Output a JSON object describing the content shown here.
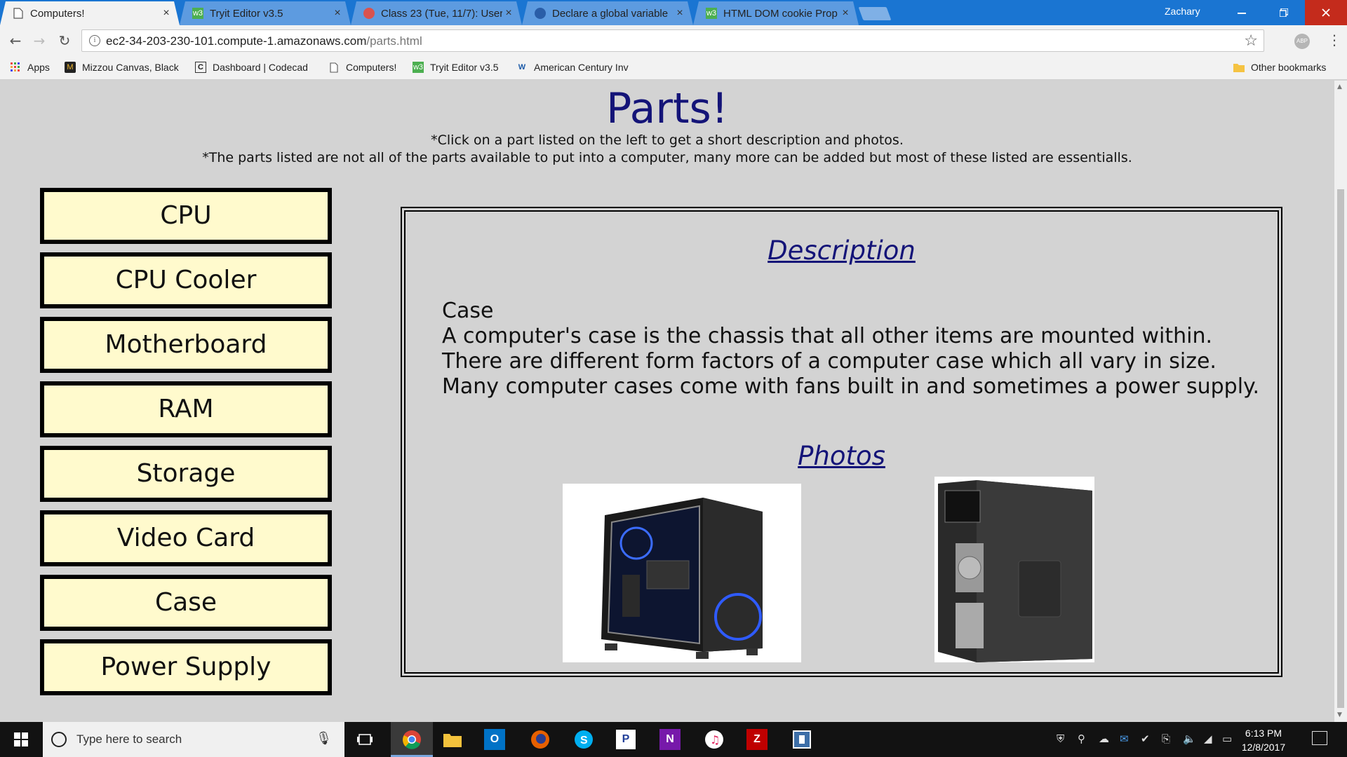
{
  "browser": {
    "tabs": [
      {
        "title": "Computers!",
        "icon": "page-icon"
      },
      {
        "title": "Tryit Editor v3.5",
        "icon": "w3schools-icon"
      },
      {
        "title": "Class 23 (Tue, 11/7): User",
        "icon": "course-icon"
      },
      {
        "title": "Declare a global variable",
        "icon": "site-icon"
      },
      {
        "title": "HTML DOM cookie Prop",
        "icon": "w3schools-icon"
      }
    ],
    "profile_name": "Zachary",
    "url_host": "ec2-34-203-230-101.compute-1.amazonaws.com",
    "url_path": "/parts.html",
    "abp_label": "ABP",
    "bookmarks": [
      {
        "label": "Apps",
        "icon": "apps-grid-icon"
      },
      {
        "label": "Mizzou Canvas, Black",
        "icon": "mizzou-icon"
      },
      {
        "label": "Dashboard | Codecad",
        "icon": "codecademy-icon"
      },
      {
        "label": "Computers!",
        "icon": "page-icon"
      },
      {
        "label": "Tryit Editor v3.5",
        "icon": "w3schools-icon"
      },
      {
        "label": "American Century Inv",
        "icon": "american-century-icon"
      }
    ],
    "other_bookmarks": "Other bookmarks"
  },
  "page": {
    "heading": "Parts!",
    "note1": "*Click on a part listed on the left to get a short description and photos.",
    "note2": "*The parts listed are not all of the parts available to put into a computer, many more can be added but most of these listed are essentialls.",
    "parts": [
      "CPU",
      "CPU Cooler",
      "Motherboard",
      "RAM",
      "Storage",
      "Video Card",
      "Case",
      "Power Supply"
    ],
    "description_title": "Description",
    "description_lines": [
      "Case",
      "A computer's case is the chassis that all other items are mounted within.",
      "There are different form factors of a computer case which all vary in size.",
      "Many computer cases come with fans built in and sometimes a power supply."
    ],
    "photos_title": "Photos"
  },
  "taskbar": {
    "search_placeholder": "Type here to search",
    "time": "6:13 PM",
    "date": "12/8/2017",
    "apps": [
      "chrome-icon",
      "file-explorer-icon",
      "outlook-icon",
      "firefox-icon",
      "skype-icon",
      "pandora-icon",
      "onenote-icon",
      "itunes-icon",
      "filezilla-icon",
      "app-icon"
    ]
  }
}
